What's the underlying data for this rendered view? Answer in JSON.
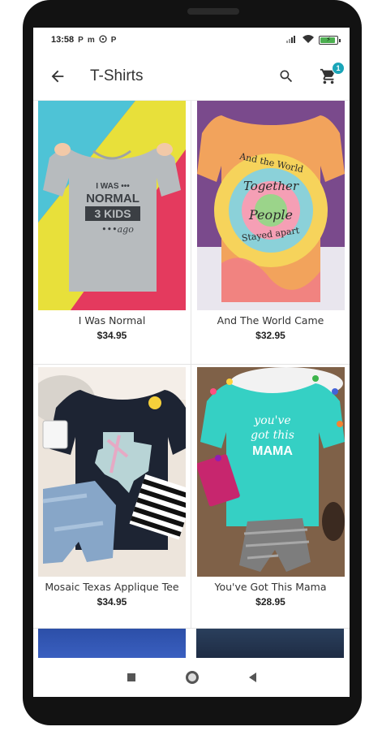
{
  "status_bar": {
    "time": "13:58",
    "notification_icons": [
      "p-icon",
      "m-icon",
      "whatsapp-icon",
      "p-icon"
    ],
    "right_icons": [
      "signal-icon",
      "wifi-icon",
      "battery-charging-icon"
    ]
  },
  "app_bar": {
    "title": "T-Shirts",
    "back_icon": "arrow-back-icon",
    "search_icon": "search-icon",
    "cart_icon": "cart-icon",
    "cart_count": "1",
    "accent_color": "#1aa5b8"
  },
  "products": [
    {
      "name": "I Was Normal",
      "price": "$34.95",
      "image": "gray-tee-3-kids"
    },
    {
      "name": "And The World Came",
      "price": "$32.95",
      "image": "tie-dye-tee"
    },
    {
      "name": "Mosaic Texas Applique Tee",
      "price": "$34.95",
      "image": "navy-texas-tee"
    },
    {
      "name": "You've Got This Mama",
      "price": "$28.95",
      "image": "teal-mama-tee"
    }
  ],
  "nav_bar": {
    "recents_icon": "recents-square-icon",
    "home_icon": "home-circle-icon",
    "back_icon": "back-triangle-icon"
  }
}
